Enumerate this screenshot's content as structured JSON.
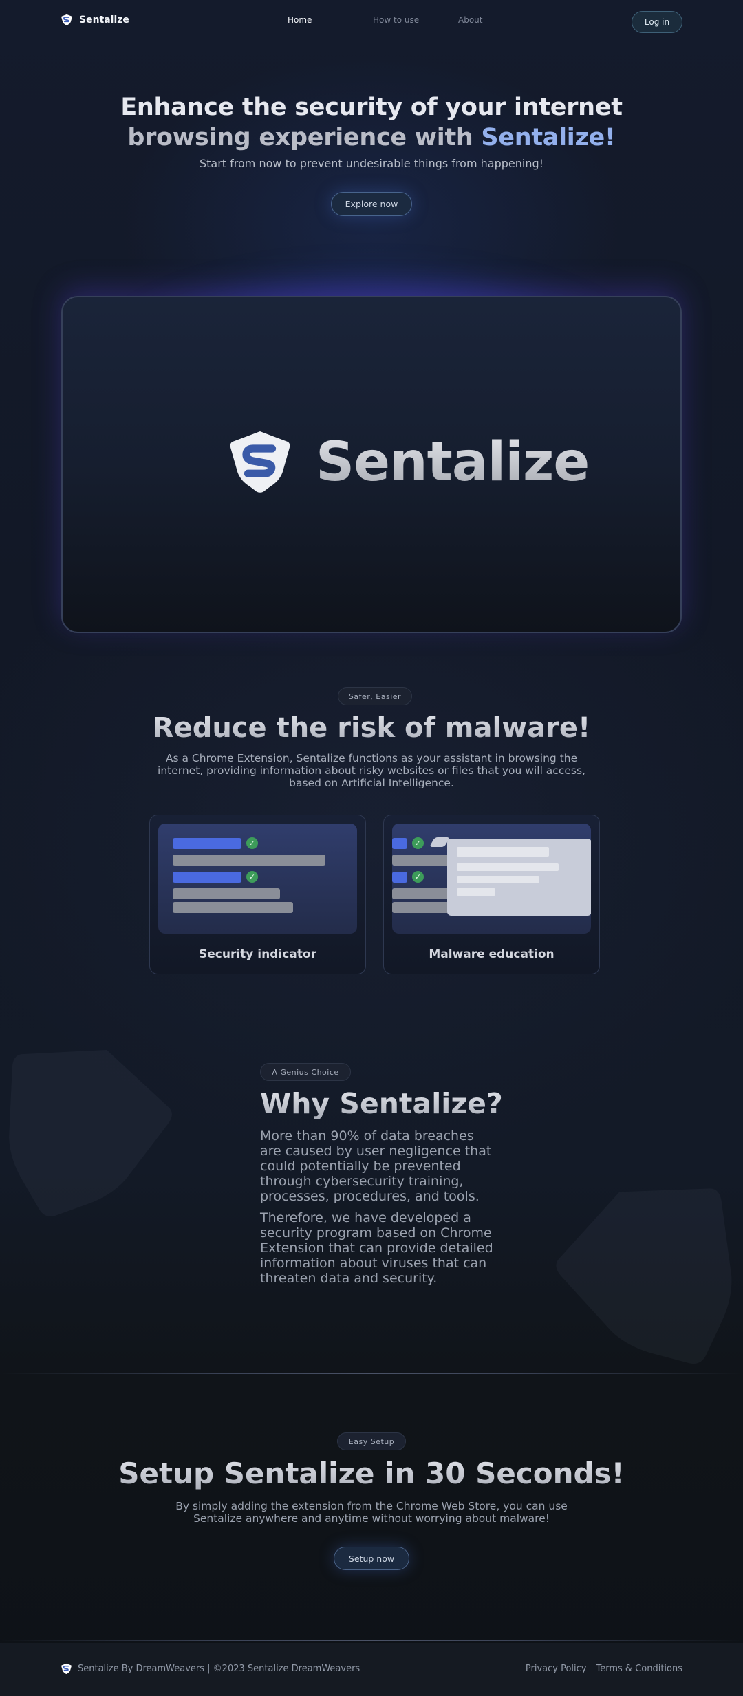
{
  "nav": {
    "brand": "Sentalize",
    "links": [
      "Home",
      "How to use",
      "About"
    ],
    "login": "Log in"
  },
  "hero": {
    "title_line1": "Enhance the security of your internet",
    "title_line2_prefix": "browsing experience with ",
    "title_accent": "Sentalize!",
    "subtitle": "Start from now to prevent undesirable things from happening!",
    "cta": "Explore now"
  },
  "showcase": {
    "wordmark": "Sentalize"
  },
  "reduce": {
    "pill": "Safer, Easier",
    "title": "Reduce the risk of malware!",
    "desc_line1": "As a Chrome Extension, Sentalize functions as your assistant in browsing the",
    "desc_line2": "internet, providing information about risky websites or files that you will access,",
    "desc_line3": "based on Artificial Intelligence.",
    "cards": [
      {
        "label": "Security indicator"
      },
      {
        "label": "Malware education"
      }
    ]
  },
  "why": {
    "pill": "A Genius Choice",
    "title": "Why Sentalize?",
    "p1": "More than 90% of data breaches are caused by user negligence that could potentially be prevented through cybersecurity training, processes, procedures, and tools.",
    "p2": "Therefore, we have developed a security program based on Chrome Extension that can provide detailed information about viruses that can threaten data and security."
  },
  "setup": {
    "pill": "Easy Setup",
    "title": "Setup Sentalize in 30 Seconds!",
    "desc_line1": "By simply adding the extension from the Chrome Web Store, you can use",
    "desc_line2": "Sentalize anywhere and anytime without worrying about malware!",
    "cta": "Setup now"
  },
  "footer": {
    "copyright": "Sentalize By DreamWeavers | ©2023 Sentalize DreamWeavers",
    "links": [
      "Privacy Policy",
      "Terms & Conditions"
    ]
  },
  "colors": {
    "accent": "#93b0ec",
    "brand_blue": "#4a6ae0",
    "check_green": "#3d9c5a"
  }
}
